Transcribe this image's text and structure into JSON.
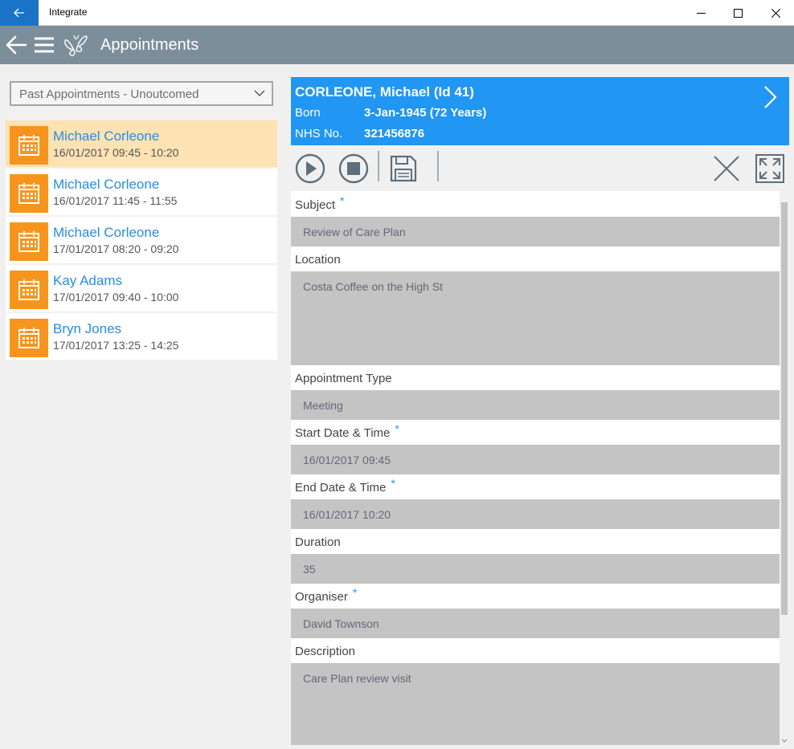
{
  "window": {
    "title": "Integrate"
  },
  "header": {
    "title": "Appointments"
  },
  "filter": {
    "value": "Past Appointments - Unoutcomed"
  },
  "appointments": [
    {
      "name": "Michael Corleone",
      "time": "16/01/2017 09:45 - 10:20",
      "selected": true
    },
    {
      "name": "Michael Corleone",
      "time": "16/01/2017 11:45 - 11:55",
      "selected": false
    },
    {
      "name": "Michael Corleone",
      "time": "17/01/2017 08:20 - 09:20",
      "selected": false
    },
    {
      "name": "Kay Adams",
      "time": "17/01/2017 09:40 - 10:00",
      "selected": false
    },
    {
      "name": "Bryn Jones",
      "time": "17/01/2017 13:25 - 14:25",
      "selected": false
    }
  ],
  "patient": {
    "name": "CORLEONE, Michael (Id 41)",
    "born_label": "Born",
    "born_value": "3-Jan-1945 (72 Years)",
    "nhs_label": "NHS No.",
    "nhs_value": "321456876"
  },
  "form": {
    "subject": {
      "label": "Subject",
      "required": "*",
      "value": "Review of Care Plan"
    },
    "location": {
      "label": "Location",
      "value": "Costa Coffee on the High St"
    },
    "appointment_type": {
      "label": "Appointment Type",
      "value": "Meeting"
    },
    "start": {
      "label": "Start Date & Time",
      "required": "*",
      "value": "16/01/2017 09:45"
    },
    "end": {
      "label": "End Date & Time",
      "required": "*",
      "value": "16/01/2017 10:20"
    },
    "duration": {
      "label": "Duration",
      "value": "35"
    },
    "organiser": {
      "label": "Organiser",
      "required": "*",
      "value": "David Townson"
    },
    "description": {
      "label": "Description",
      "value": "Care Plan review visit"
    }
  },
  "colors": {
    "accent": "#2196f3",
    "header": "#7c8e99",
    "appointment_icon": "#f7941d",
    "selected_row": "#fde2b3"
  }
}
